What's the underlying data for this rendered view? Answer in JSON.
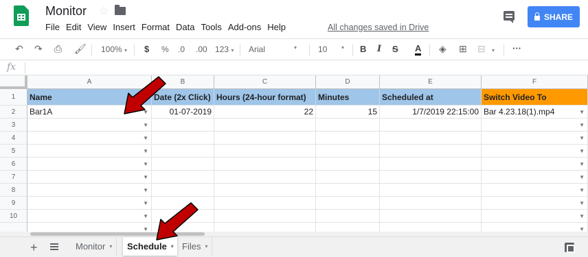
{
  "doc": {
    "title": "Monitor",
    "saved_status": "All changes saved in Drive"
  },
  "menu": [
    "File",
    "Edit",
    "View",
    "Insert",
    "Format",
    "Data",
    "Tools",
    "Add-ons",
    "Help"
  ],
  "share": {
    "label": "SHARE"
  },
  "toolbar": {
    "zoom": "100%",
    "currency": "$",
    "percent": "%",
    "decrease_decimal": ".0",
    "increase_decimal": ".00",
    "more_formats": "123",
    "font": "Arial",
    "font_size": "10",
    "bold": "B",
    "italic": "I",
    "strikethrough": "S",
    "text_color": "A",
    "more": "···"
  },
  "formula_bar": {
    "fx": "fx"
  },
  "columns": [
    "A",
    "B",
    "C",
    "D",
    "E",
    "F"
  ],
  "rows": [
    "1",
    "2",
    "3",
    "4",
    "5",
    "6",
    "7",
    "8",
    "9",
    "10"
  ],
  "table": {
    "header": [
      "Name",
      "Date (2x Click)",
      "Hours (24-hour format)",
      "Minutes",
      "Scheduled at",
      "Switch Video To"
    ],
    "row2": [
      "Bar1A",
      "01-07-2019",
      "22",
      "15",
      "1/7/2019 22:15:00",
      "Bar 4.23.18(1).mp4"
    ]
  },
  "sheets": [
    {
      "name": "Monitor",
      "active": false
    },
    {
      "name": "Schedule",
      "active": true
    },
    {
      "name": "Files",
      "active": false
    }
  ],
  "colors": {
    "header_blue": "#9fc5e8",
    "header_orange": "#ff9900",
    "share_blue": "#4285f4",
    "annotation_red": "#c00000"
  }
}
